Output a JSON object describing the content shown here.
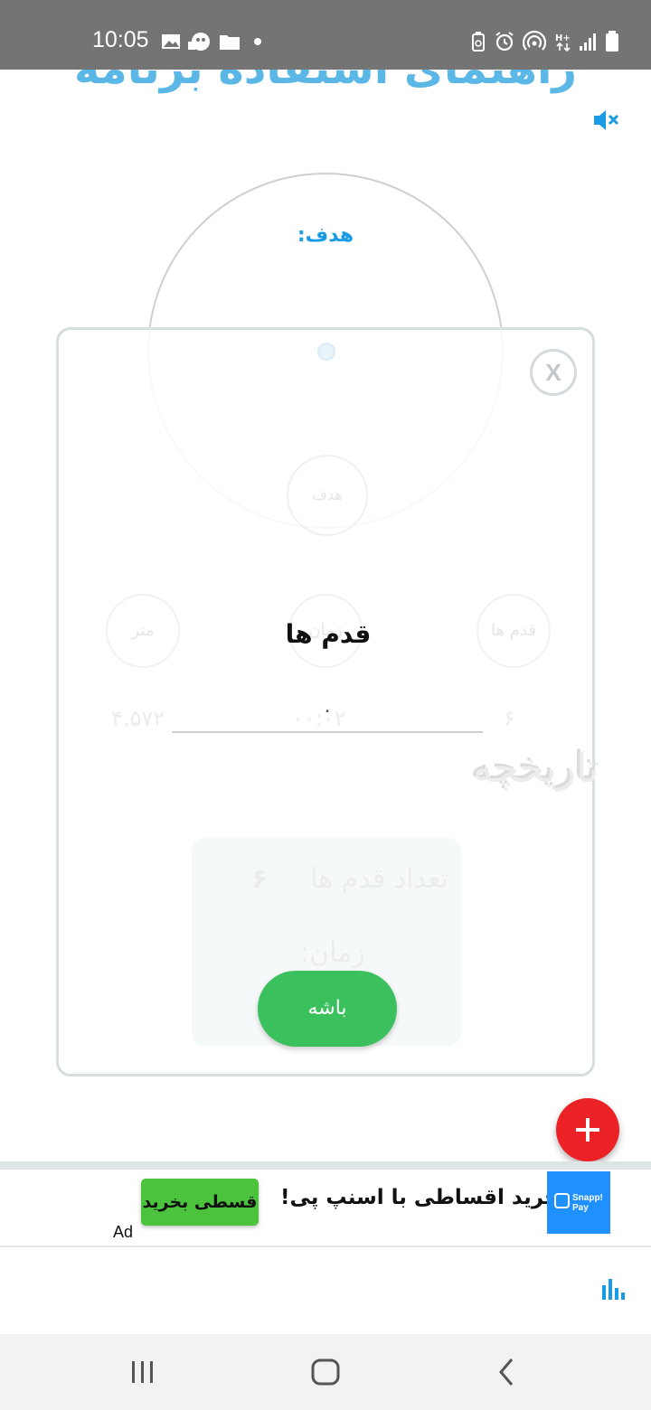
{
  "status_bar": {
    "time": "10:05"
  },
  "background": {
    "page_title": "راهنمای استفاده برنامه",
    "goal_label": "هدف:",
    "history_label": "تاریخچه",
    "faint_goal_btn": "هدف",
    "faint_steps": "قدم ها",
    "faint_time": "زمان",
    "faint_meters": "متر",
    "faint_steps_value": "۶",
    "faint_time_value": "۰۰:۰۲",
    "faint_meters_value": "۴.۵۷۲",
    "card_steps_text": "تعداد قدم ها",
    "card_steps_value": "۶",
    "card_time_text": "زمان:"
  },
  "dialog": {
    "title": "قدم ها",
    "input_value": "۰",
    "ok_label": "باشه",
    "close_label": "X"
  },
  "ad": {
    "label": "Ad",
    "text": "خرید اقساطی با اسنپ پی!",
    "button_label": "قسطی بخرید",
    "logo_line1": "Snapp!",
    "logo_line2": "Pay"
  },
  "colors": {
    "accent": "#1a9be6",
    "fab": "#ec2227",
    "ok_button": "#3ac15e",
    "ad_button": "#4cc33c"
  }
}
